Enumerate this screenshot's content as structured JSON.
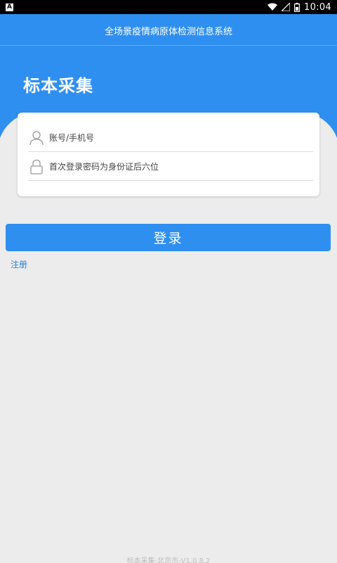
{
  "status_bar": {
    "left_icon": "A",
    "time": "10:04",
    "icons": [
      "wifi-icon",
      "signal-icon",
      "battery-icon"
    ]
  },
  "header": {
    "app_title": "全场景疫情病原体检测信息系统",
    "heading": "标本采集"
  },
  "login_form": {
    "account_placeholder": "账号/手机号",
    "password_placeholder": "首次登录密码为身份证后六位"
  },
  "actions": {
    "login_label": "登录",
    "register_label": "注册"
  },
  "footer": {
    "version": "标本采集-北京市-V1.0.8.2"
  },
  "colors": {
    "primary": "#2f8ff0",
    "background": "#ececec",
    "link": "#2a7fd8"
  }
}
